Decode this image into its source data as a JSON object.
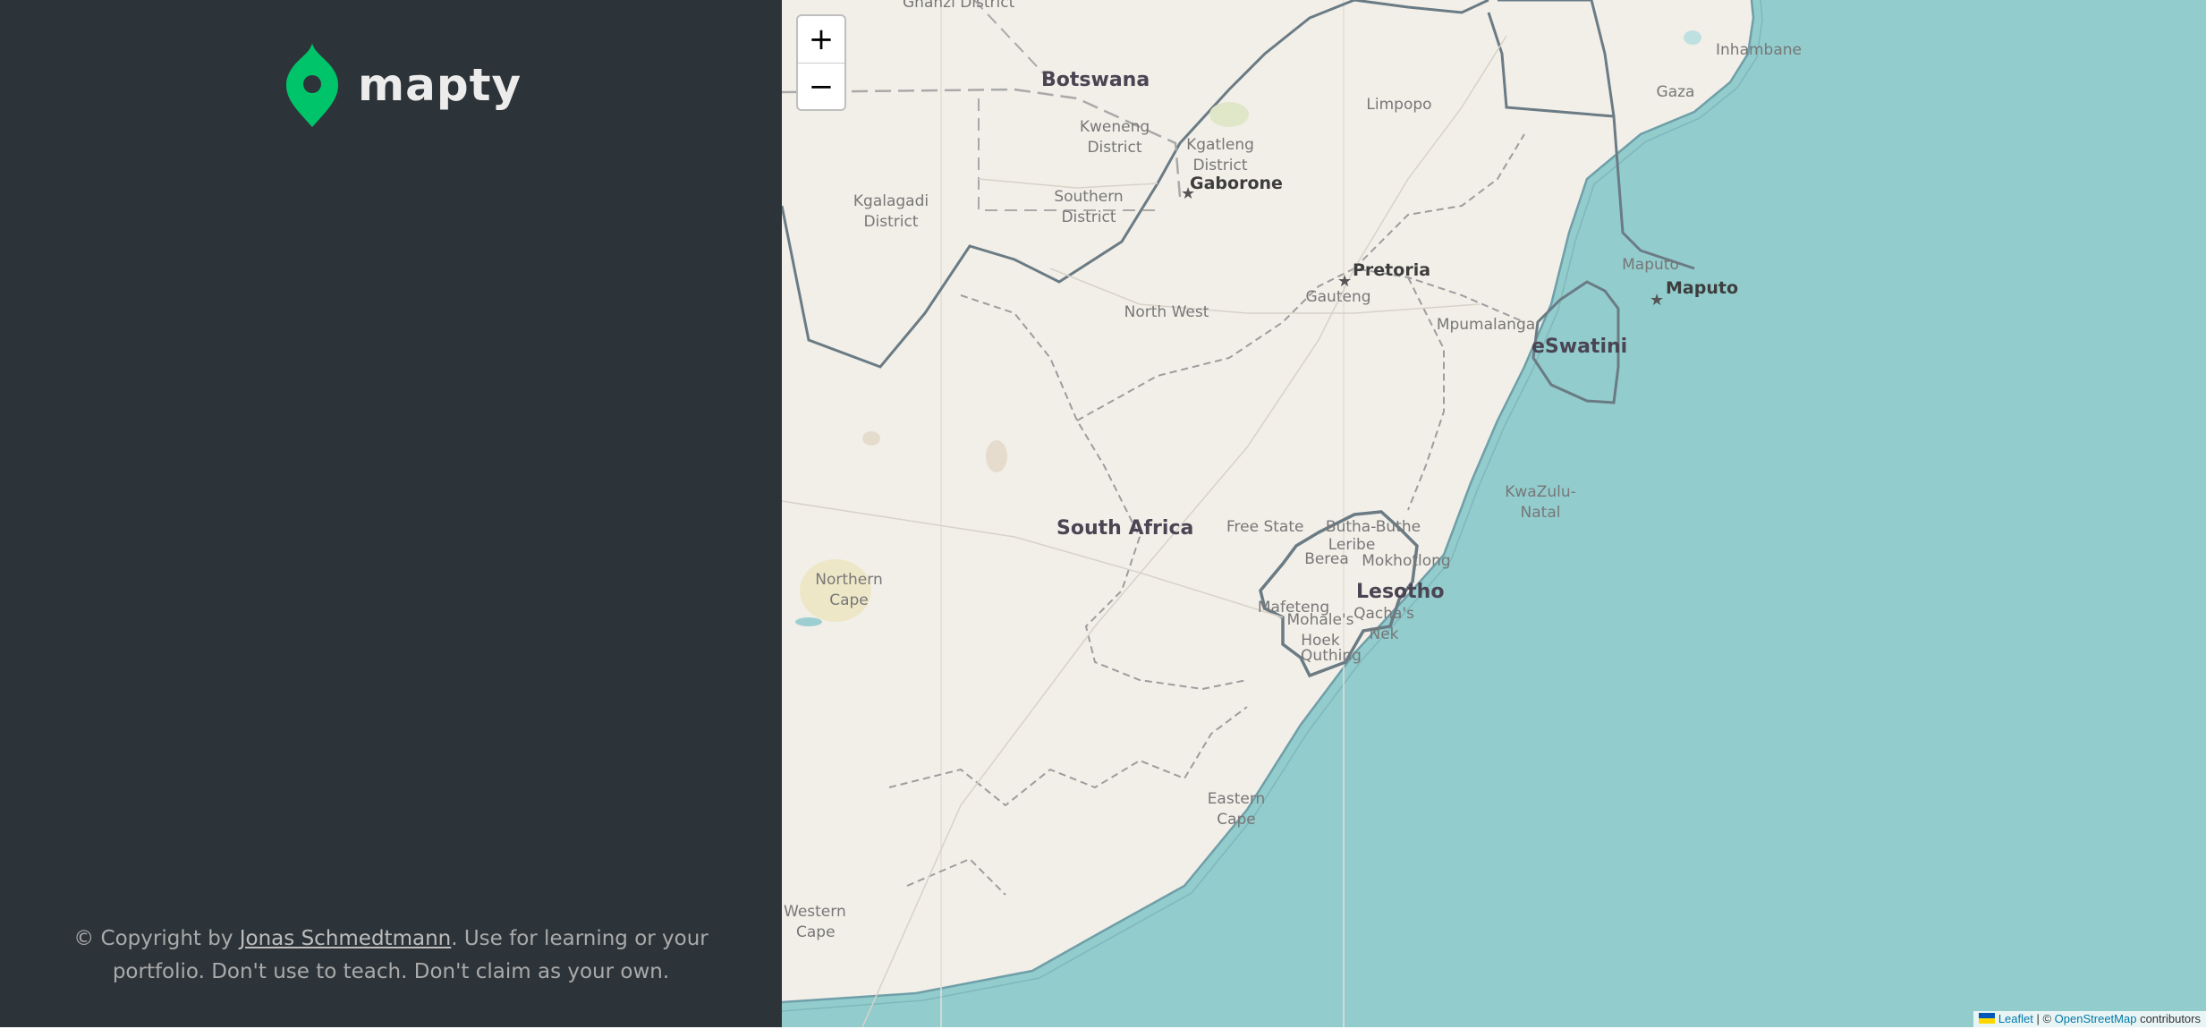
{
  "app": {
    "name": "mapty"
  },
  "footer": {
    "prefix": "© Copyright by ",
    "author": "Jonas Schmedtmann",
    "suffix": ". Use for learning or your portfolio. Don't use to teach. Don't claim as your own."
  },
  "map": {
    "zoom_in_label": "+",
    "zoom_out_label": "−",
    "attribution": {
      "leaflet": "Leaflet",
      "separator": " | © ",
      "osm": "OpenStreetMap",
      "suffix": " contributors"
    },
    "labels": {
      "ghanzi": "Ghanzi District",
      "botswana": "Botswana",
      "kweneng_1": "Kweneng",
      "kweneng_2": "District",
      "kgatleng_1": "Kgatleng",
      "kgatleng_2": "District",
      "gaborone": "Gaborone",
      "kgalagadi_1": "Kgalagadi",
      "kgalagadi_2": "District",
      "southern_1": "Southern",
      "southern_2": "District",
      "limpopo": "Limpopo",
      "inhambane": "Inhambane",
      "gaza": "Gaza",
      "pretoria": "Pretoria",
      "gauteng": "Gauteng",
      "maputo_region": "Maputo",
      "maputo": "Maputo",
      "north_west": "North West",
      "mpumalanga": "Mpumalanga",
      "eswatini": "eSwatini",
      "south_africa": "South Africa",
      "free_state": "Free State",
      "kwazulu_1": "KwaZulu-",
      "kwazulu_2": "Natal",
      "butha_buthe": "Butha-Buthe",
      "leribe": "Leribe",
      "berea": "Berea",
      "mokhotlong": "Mokhotlong",
      "lesotho": "Lesotho",
      "mafeteng": "Mafeteng",
      "mohales_hoek_1": "Mohale's",
      "mohales_hoek_2": "Hoek",
      "qachas_nek_1": "Qacha's",
      "qachas_nek_2": "Nek",
      "quthing": "Quthing",
      "northern_cape_1": "Northern",
      "northern_cape_2": "Cape",
      "eastern_cape_1": "Eastern",
      "eastern_cape_2": "Cape",
      "western_cape_1": "Western",
      "western_cape_2": "Cape"
    }
  },
  "colors": {
    "sidebar_bg": "#2d3439",
    "brand_green": "#00c46a",
    "land": "#f2efe9",
    "sea": "#93cccd",
    "border_country": "#6a7b84"
  }
}
